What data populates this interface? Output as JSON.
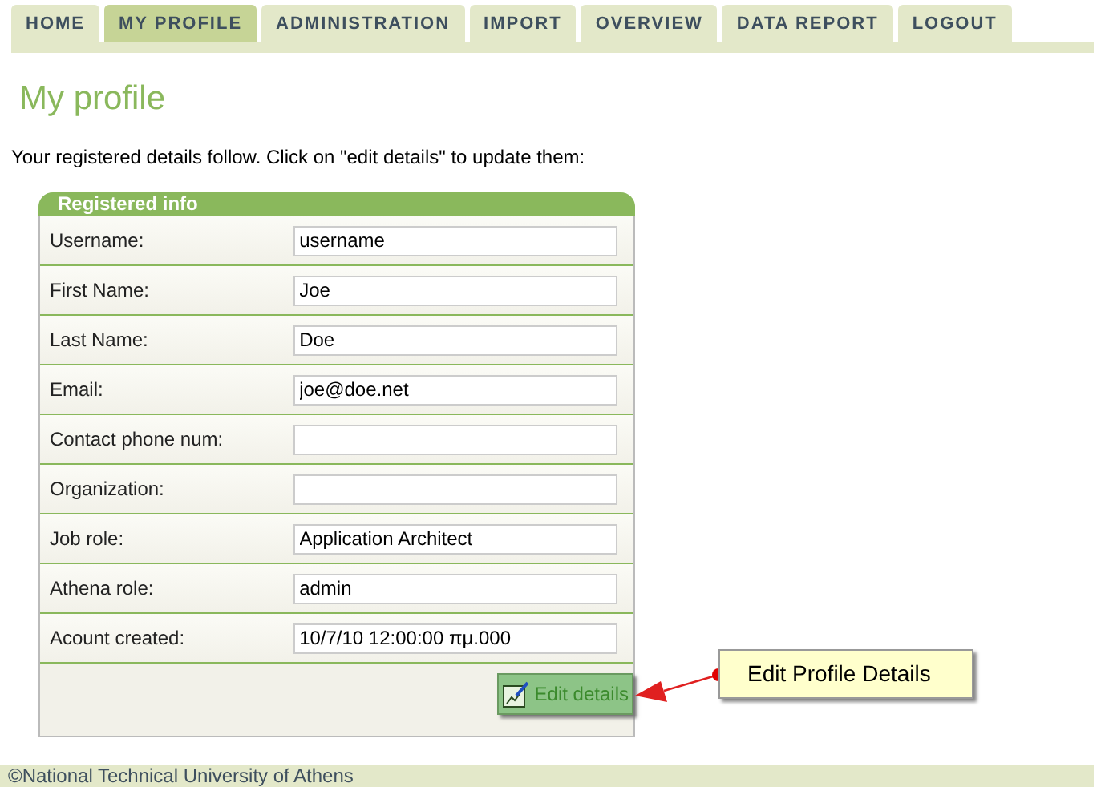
{
  "tabs": [
    {
      "label": "HOME",
      "selected": false
    },
    {
      "label": "MY PROFILE",
      "selected": true
    },
    {
      "label": "ADMINISTRATION",
      "selected": false
    },
    {
      "label": "IMPORT",
      "selected": false
    },
    {
      "label": "OVERVIEW",
      "selected": false
    },
    {
      "label": "DATA REPORT",
      "selected": false
    },
    {
      "label": "LOGOUT",
      "selected": false
    }
  ],
  "heading": "My profile",
  "intro": "Your registered details follow. Click on \"edit details\" to update them:",
  "panel": {
    "title": "Registered info",
    "fields": [
      {
        "label": "Username:",
        "value": "username"
      },
      {
        "label": "First Name:",
        "value": "Joe"
      },
      {
        "label": "Last Name:",
        "value": "Doe"
      },
      {
        "label": "Email:",
        "value": "joe@doe.net"
      },
      {
        "label": "Contact phone num:"
      },
      {
        "label": "Organization:"
      },
      {
        "label": "Job role:",
        "value": "Application Architect"
      },
      {
        "label": "Athena role:",
        "value": "admin"
      },
      {
        "label": "Acount created:",
        "value": "10/7/10 12:00:00 πμ.000"
      }
    ],
    "button": "Edit details"
  },
  "callout": "Edit Profile Details",
  "footer": "©National Technical University of Athens"
}
